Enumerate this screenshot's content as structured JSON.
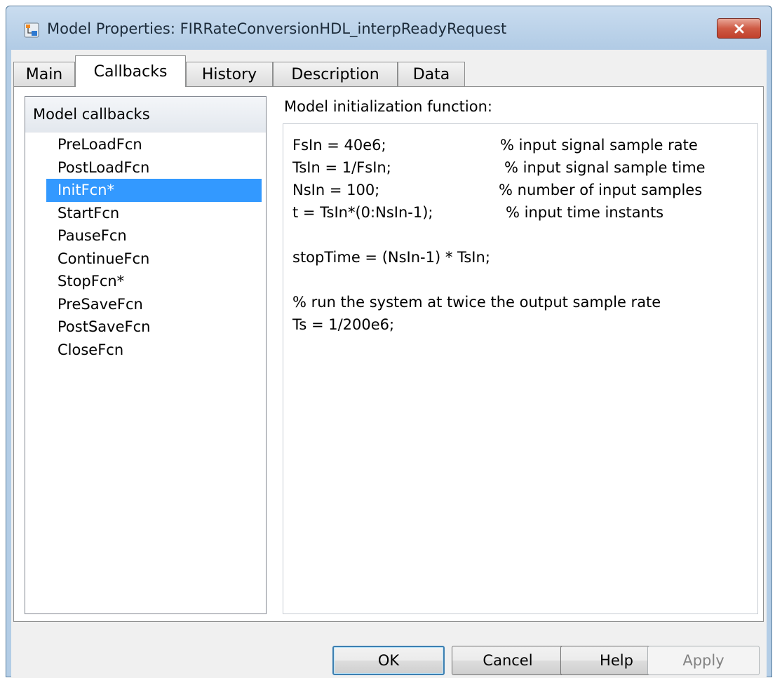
{
  "window": {
    "title": "Model Properties: FIRRateConversionHDL_interpReadyRequest",
    "icon": "simulink-model-icon",
    "close_icon": "close-icon"
  },
  "tabs": [
    {
      "label": "Main",
      "active": false
    },
    {
      "label": "Callbacks",
      "active": true
    },
    {
      "label": "History",
      "active": false
    },
    {
      "label": "Description",
      "active": false
    },
    {
      "label": "Data",
      "active": false
    }
  ],
  "callbacks": {
    "header": "Model callbacks",
    "items": [
      {
        "label": "PreLoadFcn"
      },
      {
        "label": "PostLoadFcn"
      },
      {
        "label": "InitFcn*",
        "selected": true
      },
      {
        "label": "StartFcn"
      },
      {
        "label": "PauseFcn"
      },
      {
        "label": "ContinueFcn"
      },
      {
        "label": "StopFcn*"
      },
      {
        "label": "PreSaveFcn"
      },
      {
        "label": "PostSaveFcn"
      },
      {
        "label": "CloseFcn"
      }
    ]
  },
  "editor": {
    "label": "Model initialization function:",
    "lines": [
      {
        "code": "FsIn = 40e6;",
        "comment": "% input signal sample rate"
      },
      {
        "code": "TsIn = 1/FsIn;",
        "comment": "% input signal sample time"
      },
      {
        "code": "NsIn = 100;",
        "comment": "% number of input samples"
      },
      {
        "code": "t = TsIn*(0:NsIn-1);",
        "comment": "% input time instants"
      },
      {
        "code": "",
        "comment": ""
      },
      {
        "code": "stopTime = (NsIn-1) * TsIn;",
        "comment": ""
      },
      {
        "code": "",
        "comment": ""
      },
      {
        "code": "% run the system at twice the output sample rate",
        "comment": ""
      },
      {
        "code": "Ts = 1/200e6;",
        "comment": ""
      }
    ]
  },
  "buttons": {
    "ok": "OK",
    "cancel": "Cancel",
    "help": "Help",
    "apply": "Apply"
  },
  "colors": {
    "selection": "#3399ff",
    "titlebar": "#b9d1ea",
    "close_button": "#c7432d"
  }
}
